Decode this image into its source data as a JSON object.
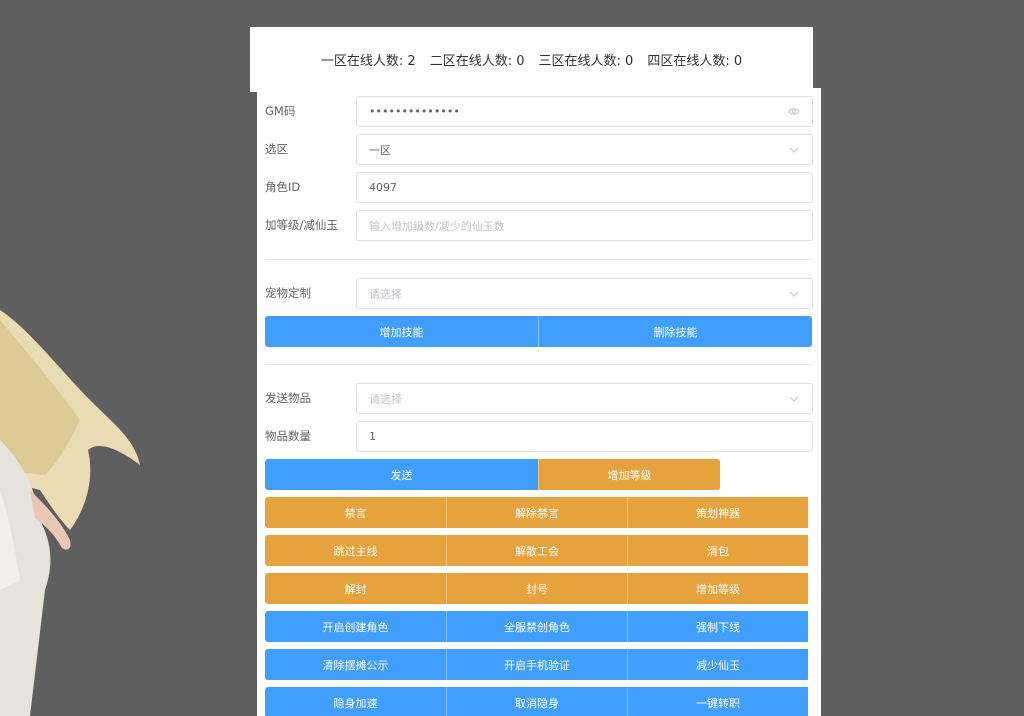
{
  "online": [
    {
      "label": "一区在线人数:",
      "count": "2"
    },
    {
      "label": "二区在线人数:",
      "count": "0"
    },
    {
      "label": "三区在线人数:",
      "count": "0"
    },
    {
      "label": "四区在线人数:",
      "count": "0"
    }
  ],
  "form": {
    "gm_code": {
      "label": "GM码",
      "value": "••••••••••••••"
    },
    "zone": {
      "label": "选区",
      "value": "一区"
    },
    "role_id": {
      "label": "角色ID",
      "value": "4097"
    },
    "level_jade": {
      "label": "加等级/减仙玉",
      "placeholder": "输入增加级数/减少的仙玉数"
    },
    "pet": {
      "label": "宠物定制",
      "placeholder": "请选择"
    },
    "item": {
      "label": "发送物品",
      "placeholder": "请选择"
    },
    "item_qty": {
      "label": "物品数量",
      "value": "1"
    }
  },
  "skill_buttons": [
    "增加技能",
    "删除技能"
  ],
  "send_buttons": [
    "发送",
    "增加等级"
  ],
  "action_rows": [
    {
      "color": "orange",
      "labels": [
        "禁言",
        "解除禁言",
        "策划神器"
      ]
    },
    {
      "color": "orange",
      "labels": [
        "跳过主线",
        "解散工会",
        "清包"
      ]
    },
    {
      "color": "orange",
      "labels": [
        "解封",
        "封号",
        "增加等级"
      ]
    },
    {
      "color": "blue",
      "labels": [
        "开启创建角色",
        "全服禁创角色",
        "强制下线"
      ]
    },
    {
      "color": "blue",
      "labels": [
        "清除摆摊公示",
        "开启手机验证",
        "减少仙玉"
      ]
    },
    {
      "color": "blue",
      "labels": [
        "隐身加速",
        "取消隐身",
        "一键转职"
      ]
    }
  ],
  "colors": {
    "primary": "#409eff",
    "warning": "#e6a23c",
    "background": "#5f5f5f"
  },
  "icons": {
    "password_toggle": "eye-icon",
    "select_arrow": "chevron-down-icon"
  }
}
